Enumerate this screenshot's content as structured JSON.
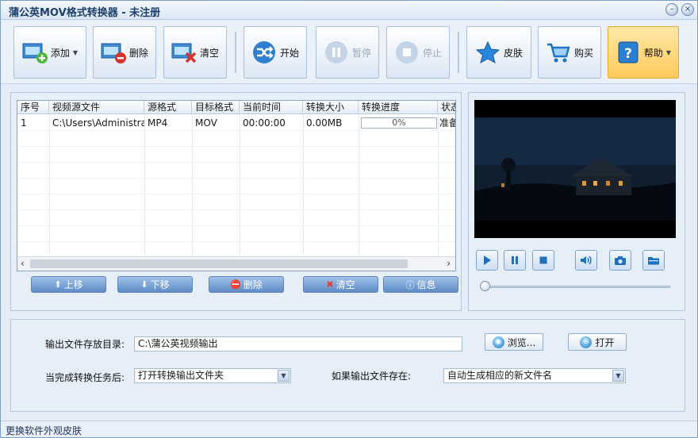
{
  "window": {
    "title": "蒲公英MOV格式转换器 - 未注册",
    "minimize_glyph": "–",
    "close_glyph": "×"
  },
  "toolbar": {
    "add": "添加",
    "delete": "删除",
    "clear": "清空",
    "start": "开始",
    "pause": "暂停",
    "stop": "停止",
    "skin": "皮肤",
    "buy": "购买",
    "help": "帮助"
  },
  "table": {
    "columns": [
      "序号",
      "视频源文件",
      "源格式",
      "目标格式",
      "当前时间",
      "转换大小",
      "转换进度",
      "状态"
    ],
    "rows": [
      {
        "index": "1",
        "source": "C:\\Users\\Administrator...",
        "src_format": "MP4",
        "dst_format": "MOV",
        "current_time": "00:00:00",
        "size": "0.00MB",
        "progress_label": "0%",
        "progress": 0,
        "status": "准备"
      }
    ]
  },
  "list_buttons": {
    "move_up": "上移",
    "move_down": "下移",
    "delete": "删除",
    "clear": "清空",
    "info": "信息"
  },
  "player": {
    "position": 0,
    "controls": [
      "play-icon",
      "pause-icon",
      "stop-icon",
      "volume-icon",
      "camera-icon",
      "folder-icon"
    ]
  },
  "settings": {
    "output_dir_label": "输出文件存放目录:",
    "output_dir_value": "C:\\蒲公英视频输出",
    "browse": "浏览...",
    "open": "打开",
    "after_complete_label": "当完成转换任务后:",
    "after_complete_value": "打开转换输出文件夹",
    "if_exists_label": "如果输出文件存在:",
    "if_exists_value": "自动生成相应的新文件名"
  },
  "status_bar": {
    "text": "更换软件外观皮肤"
  },
  "colors": {
    "accent": "#5f8dc7",
    "help_active": "#ffcb5c",
    "panel_bg": "#e6eef8"
  }
}
